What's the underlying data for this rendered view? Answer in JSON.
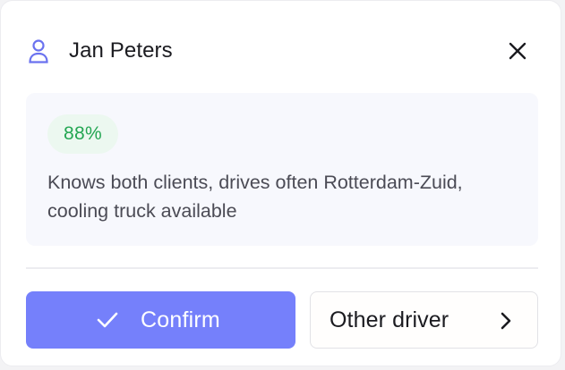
{
  "header": {
    "user_icon": "user-icon",
    "name": "Jan Peters",
    "close_icon": "close-icon"
  },
  "match": {
    "score_label": "88%",
    "score": 0.88,
    "reason": "Knows both clients, drives often Rotterdam-Zuid, cooling truck available"
  },
  "actions": {
    "confirm_label": "Confirm",
    "confirm_icon": "check-icon",
    "other_label": "Other driver",
    "other_icon": "chevron-right-icon"
  },
  "colors": {
    "accent": "#7580fb",
    "user_icon": "#6a72ef",
    "badge_bg": "#ecf8f0",
    "badge_text": "#23a652",
    "panel_bg": "#f7f8fd"
  }
}
